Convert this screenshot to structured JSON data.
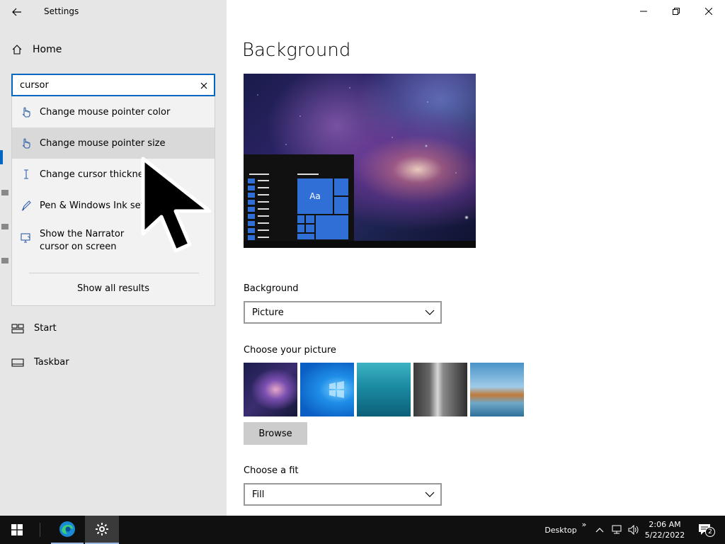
{
  "window": {
    "app_title": "Settings"
  },
  "sidebar": {
    "home_label": "Home",
    "search": {
      "value": "cursor",
      "placeholder": ""
    },
    "suggestions": [
      {
        "label": "Change mouse pointer color",
        "icon": "hand-pointer-icon"
      },
      {
        "label": "Change mouse pointer size",
        "icon": "hand-pointer-icon"
      },
      {
        "label": "Change cursor thickne",
        "icon": "text-cursor-icon"
      },
      {
        "label": "Pen & Windows Ink set",
        "icon": "pen-icon"
      },
      {
        "label": "Show the Narrator cursor on screen",
        "icon": "narrator-icon"
      }
    ],
    "show_all": "Show all results",
    "nav": [
      {
        "label": "Start",
        "icon": "start-icon"
      },
      {
        "label": "Taskbar",
        "icon": "taskbar-icon"
      }
    ]
  },
  "main": {
    "page_title": "Background",
    "preview_tile_label": "Aa",
    "background_label": "Background",
    "background_value": "Picture",
    "choose_picture_label": "Choose your picture",
    "browse_label": "Browse",
    "fit_label": "Choose a fit",
    "fit_value": "Fill"
  },
  "taskbar": {
    "desktop_label": "Desktop",
    "time": "2:06 AM",
    "date": "5/22/2022",
    "notification_count": "2"
  },
  "colors": {
    "accent": "#0067c0",
    "sidebar_bg": "#e6e6e6",
    "taskbar_bg": "#101010"
  }
}
